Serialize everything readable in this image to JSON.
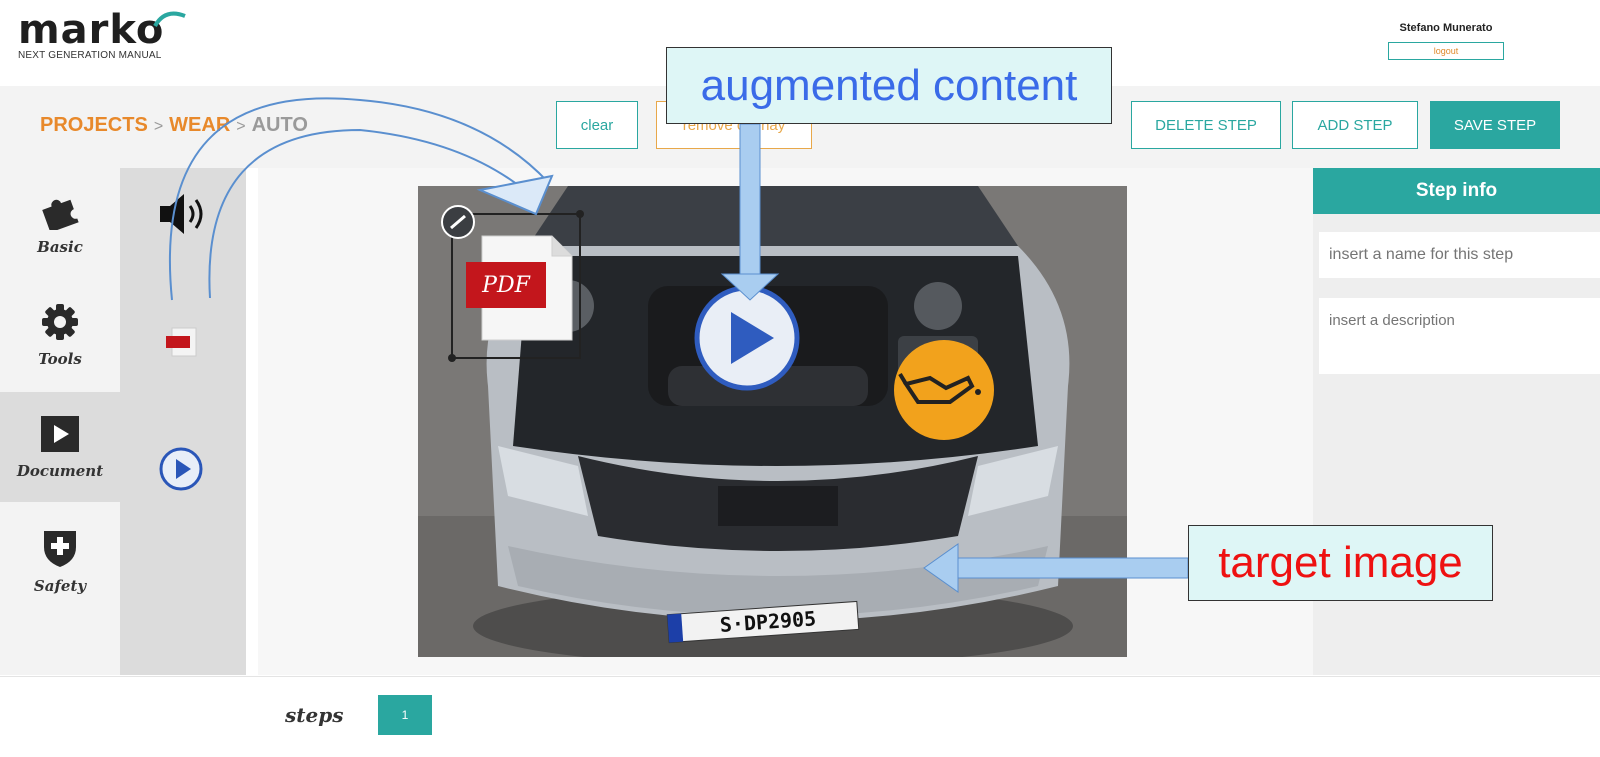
{
  "header": {
    "logo_text": "marko",
    "logo_tagline": "NEXT GENERATION MANUAL",
    "user_name": "Stefano Munerato",
    "logout_label": "logout"
  },
  "breadcrumb": [
    "PROJECTS",
    "WEAR",
    "AUTO"
  ],
  "breadcrumb_sep": ">",
  "toolbar": {
    "clear_label": "clear",
    "remove_overlay_label": "remove overlay",
    "delete_step_label": "DELETE STEP",
    "add_step_label": "ADD STEP",
    "save_step_label": "SAVE STEP"
  },
  "categories": [
    {
      "label": "Basic",
      "icon": "puzzle-icon"
    },
    {
      "label": "Tools",
      "icon": "gear-icon"
    },
    {
      "label": "Document",
      "icon": "play-square-icon",
      "active": true
    },
    {
      "label": "Safety",
      "icon": "shield-plus-icon"
    }
  ],
  "assets": [
    {
      "icon": "speaker-icon"
    },
    {
      "icon": "pdf-icon"
    },
    {
      "icon": "video-play-icon"
    }
  ],
  "canvas": {
    "pdf_label": "PDF",
    "plate_text": "S·DP2905"
  },
  "step_info": {
    "title": "Step info",
    "name_placeholder": "insert a name for this step",
    "description_placeholder": "insert a description"
  },
  "footer": {
    "steps_label": "steps",
    "current_step": "1"
  },
  "annotations": {
    "augmented_content": "augmented content",
    "target_image": "target image"
  },
  "colors": {
    "accent": "#2aa7a0",
    "orange": "#e8892b",
    "callout_blue": "#3a6be8",
    "callout_red": "#ee1111",
    "oil_badge": "#f2a21c"
  }
}
